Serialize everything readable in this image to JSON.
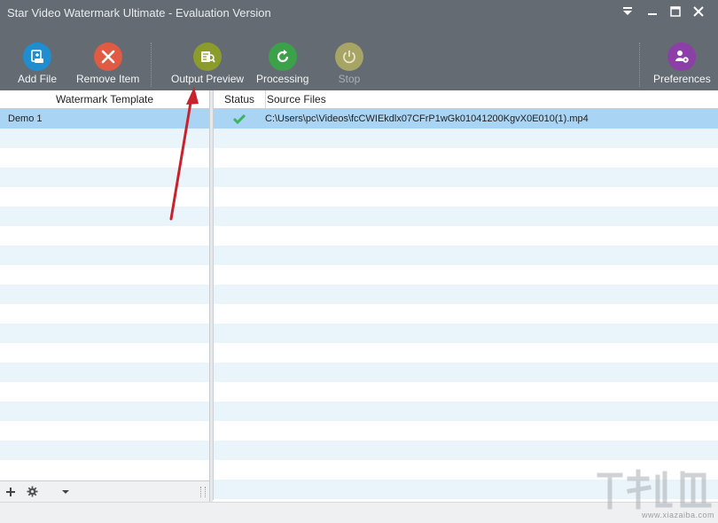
{
  "window": {
    "title": "Star Video Watermark Ultimate - Evaluation Version"
  },
  "toolbar": {
    "add_file": "Add File",
    "remove_item": "Remove Item",
    "output_preview": "Output Preview",
    "processing": "Processing",
    "stop": "Stop",
    "preferences": "Preferences"
  },
  "left_panel": {
    "header": "Watermark Template",
    "items": [
      "Demo 1"
    ]
  },
  "right_panel": {
    "columns": [
      "Status",
      "Source Files"
    ],
    "rows": [
      {
        "status": "done",
        "source": "C:\\Users\\pc\\Videos\\fcCWIEkdlx07CFrP1wGk01041200KgvX0E010(1).mp4"
      }
    ]
  },
  "watermark": {
    "url": "www.xiazaiba.com"
  },
  "colors": {
    "toolbar_bg": "#646b73",
    "selected_row": "#a9d4f3",
    "alt_row": "#e9f5fb",
    "add_file_icon": "#1f8ed0",
    "remove_icon": "#e05a44",
    "preview_icon": "#8b9b2c",
    "processing_icon": "#3ca24a",
    "stop_icon": "#a7a566",
    "preferences_icon": "#8b3fa7",
    "status_ok": "#3cb55e",
    "annotation": "#c8232c"
  }
}
